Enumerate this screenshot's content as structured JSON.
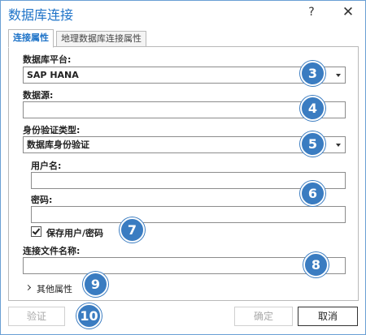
{
  "window": {
    "title": "数据库连接",
    "help_label": "?",
    "close_label": "✕"
  },
  "tabs": [
    {
      "label": "连接属性"
    },
    {
      "label": "地理数据库连接属性"
    }
  ],
  "form": {
    "platform_label": "数据库平台:",
    "platform_value": "SAP HANA",
    "datasource_label": "数据源:",
    "datasource_value": "",
    "auth_label": "身份验证类型:",
    "auth_value": "数据库身份验证",
    "username_label": "用户名:",
    "username_value": "",
    "password_label": "密码:",
    "password_value": "",
    "save_checkbox_label": "保存用户/密码",
    "save_checked": true,
    "filename_label": "连接文件名称:",
    "filename_value": "",
    "other_props_label": "其他属性"
  },
  "badges": [
    "3",
    "4",
    "5",
    "6",
    "7",
    "8",
    "9",
    "10"
  ],
  "buttons": {
    "validate": "验证",
    "ok": "确定",
    "cancel": "取消"
  },
  "colors": {
    "accent": "#1e73c8",
    "badge": "#3a7cc1"
  }
}
